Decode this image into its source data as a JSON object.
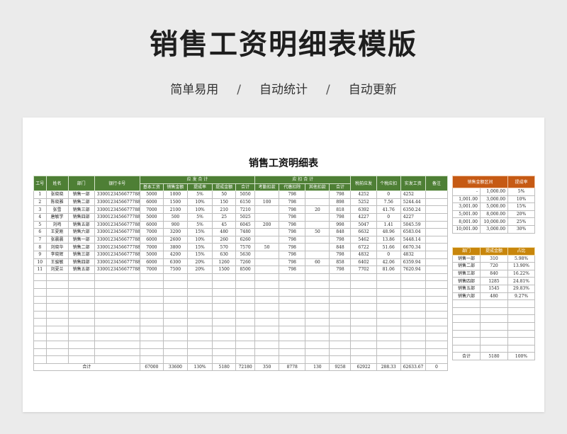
{
  "hero": {
    "title": "销售工资明细表模版",
    "features": [
      "简单易用",
      "自动统计",
      "自动更新"
    ],
    "separator": "/"
  },
  "sheet": {
    "title": "销售工资明细表",
    "header_top": [
      "工号",
      "姓名",
      "部门",
      "银行卡号",
      "应发合计",
      "应扣合计",
      "税前应发",
      "个税应扣",
      "实发工资",
      "备注"
    ],
    "header_top_display": [
      "工号",
      "姓名",
      "部门",
      "银行卡号",
      "应 发 合 计",
      "应 扣 合 计",
      "税前应发",
      "个税应扣",
      "实发工资",
      "备注"
    ],
    "header_sub": [
      "基本工资",
      "销售金额",
      "提成率",
      "提成金额",
      "合计",
      "考勤扣款",
      "代缴扣除",
      "其他扣款",
      "合计"
    ],
    "rows": [
      [
        "1",
        "张晓晓",
        "销售一部",
        "3300123456677788",
        "5000",
        "1000",
        "5%",
        "50",
        "5050",
        "",
        "798",
        "",
        "798",
        "4252",
        "0",
        "4252",
        ""
      ],
      [
        "2",
        "陈晓雅",
        "销售二部",
        "3300123456677788",
        "6000",
        "1500",
        "10%",
        "150",
        "6150",
        "100",
        "798",
        "",
        "898",
        "5252",
        "7.56",
        "5244.44",
        ""
      ],
      [
        "3",
        "张雪",
        "销售三部",
        "3300123456677788",
        "7000",
        "2100",
        "10%",
        "210",
        "7210",
        "",
        "798",
        "20",
        "818",
        "6392",
        "41.76",
        "6350.24",
        ""
      ],
      [
        "4",
        "唐敏学",
        "销售四部",
        "3300123456677788",
        "5000",
        "500",
        "5%",
        "25",
        "5025",
        "",
        "798",
        "",
        "798",
        "4227",
        "0",
        "4227",
        ""
      ],
      [
        "5",
        "刘鸣",
        "销售五部",
        "3300123456677788",
        "6000",
        "900",
        "5%",
        "45",
        "6045",
        "200",
        "798",
        "",
        "998",
        "5047",
        "1.41",
        "5045.59",
        ""
      ],
      [
        "6",
        "王夏刚",
        "销售六部",
        "3300123456677788",
        "7000",
        "3200",
        "15%",
        "480",
        "7480",
        "",
        "798",
        "50",
        "848",
        "6632",
        "48.96",
        "6583.04",
        ""
      ],
      [
        "7",
        "张晨晨",
        "销售一部",
        "3300123456677788",
        "6000",
        "2600",
        "10%",
        "260",
        "6260",
        "",
        "798",
        "",
        "798",
        "5462",
        "13.86",
        "5448.14",
        ""
      ],
      [
        "8",
        "刘晓华",
        "销售二部",
        "3300123456677788",
        "7000",
        "3800",
        "15%",
        "570",
        "7570",
        "50",
        "798",
        "",
        "848",
        "6722",
        "51.66",
        "6670.34",
        ""
      ],
      [
        "9",
        "李晓辉",
        "销售三部",
        "3300123456677788",
        "5000",
        "4200",
        "15%",
        "630",
        "5630",
        "",
        "798",
        "",
        "798",
        "4832",
        "0",
        "4832",
        ""
      ],
      [
        "10",
        "王骏敏",
        "销售四部",
        "3300123456677788",
        "6000",
        "6300",
        "20%",
        "1260",
        "7260",
        "",
        "798",
        "60",
        "858",
        "6402",
        "42.06",
        "6359.94",
        ""
      ],
      [
        "11",
        "刘夏兰",
        "销售五部",
        "3300123456677788",
        "7000",
        "7500",
        "20%",
        "1500",
        "8500",
        "",
        "798",
        "",
        "798",
        "7702",
        "81.06",
        "7620.94",
        ""
      ]
    ],
    "empty_rows": 12,
    "total": {
      "label": "合计",
      "values": [
        "67000",
        "33600",
        "130%",
        "5180",
        "72180",
        "350",
        "8778",
        "130",
        "9258",
        "62922",
        "288.33",
        "62633.67",
        "0"
      ]
    }
  },
  "commission_table": {
    "headers": [
      "销售金额区间",
      "提成率"
    ],
    "rows": [
      [
        "-",
        "1,000.00",
        "5%"
      ],
      [
        "1,001.00",
        "3,000.00",
        "10%"
      ],
      [
        "3,001.00",
        "5,000.00",
        "15%"
      ],
      [
        "5,001.00",
        "8,000.00",
        "20%"
      ],
      [
        "8,001.00",
        "10,000.00",
        "25%"
      ],
      [
        "10,001.00",
        "3,000.00",
        "30%"
      ]
    ]
  },
  "department_table": {
    "headers": [
      "部门",
      "提成金额",
      "占比"
    ],
    "rows": [
      [
        "销售一部",
        "310",
        "5.98%"
      ],
      [
        "销售二部",
        "720",
        "13.90%"
      ],
      [
        "销售三部",
        "840",
        "16.22%"
      ],
      [
        "销售四部",
        "1285",
        "24.81%"
      ],
      [
        "销售五部",
        "1545",
        "29.83%"
      ],
      [
        "销售六部",
        "480",
        "9.27%"
      ]
    ],
    "empty_rows": 7,
    "total": [
      "合计",
      "5180",
      "100%"
    ]
  },
  "colors": {
    "main_header": "#4e7f35",
    "commission_header": "#c65a14",
    "department_header": "#c8860b"
  }
}
